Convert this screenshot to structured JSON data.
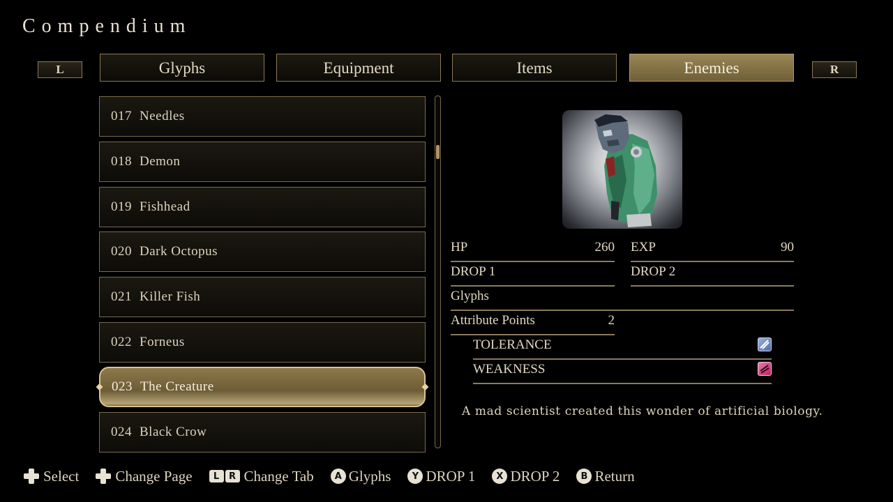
{
  "title": "Compendium",
  "shoulders": {
    "left": "L",
    "right": "R"
  },
  "tabs": [
    {
      "label": "Glyphs",
      "active": false
    },
    {
      "label": "Equipment",
      "active": false
    },
    {
      "label": "Items",
      "active": false
    },
    {
      "label": "Enemies",
      "active": true
    }
  ],
  "list": [
    {
      "num": "017",
      "name": "Needles",
      "selected": false
    },
    {
      "num": "018",
      "name": "Demon",
      "selected": false
    },
    {
      "num": "019",
      "name": "Fishhead",
      "selected": false
    },
    {
      "num": "020",
      "name": "Dark Octopus",
      "selected": false
    },
    {
      "num": "021",
      "name": "Killer Fish",
      "selected": false
    },
    {
      "num": "022",
      "name": "Forneus",
      "selected": false
    },
    {
      "num": "023",
      "name": "The Creature",
      "selected": true
    },
    {
      "num": "024",
      "name": "Black Crow",
      "selected": false
    }
  ],
  "details": {
    "hp_label": "HP",
    "hp_value": "260",
    "exp_label": "EXP",
    "exp_value": "90",
    "drop1_label": "DROP 1",
    "drop1_value": "",
    "drop2_label": "DROP 2",
    "drop2_value": "",
    "glyphs_label": "Glyphs",
    "glyphs_value": "",
    "attr_label": "Attribute Points",
    "attr_value": "2",
    "tolerance_label": "TOLERANCE",
    "tolerance_icon": "slash-attribute-icon",
    "weakness_label": "WEAKNESS",
    "weakness_icon": "fire-attribute-icon",
    "description": "A mad scientist created this wonder of artificial biology."
  },
  "footer": [
    {
      "icon": "dpad-icon",
      "label": "Select"
    },
    {
      "icon": "dpad-icon",
      "label": "Change Page"
    },
    {
      "icon": "lr-buttons-icon",
      "glyphs": [
        "L",
        "R"
      ],
      "label": "Change Tab"
    },
    {
      "icon": "a-button-icon",
      "glyph": "A",
      "label": "Glyphs"
    },
    {
      "icon": "y-button-icon",
      "glyph": "Y",
      "label": "DROP 1"
    },
    {
      "icon": "x-button-icon",
      "glyph": "X",
      "label": "DROP 2"
    },
    {
      "icon": "b-button-icon",
      "glyph": "B",
      "label": "Return"
    }
  ],
  "colors": {
    "accent_gold": "#8d784a",
    "border": "#8c7a55",
    "text": "#e6dccb",
    "tolerance_icon": "#7f95c8",
    "weakness_icon": "#d8317c"
  }
}
